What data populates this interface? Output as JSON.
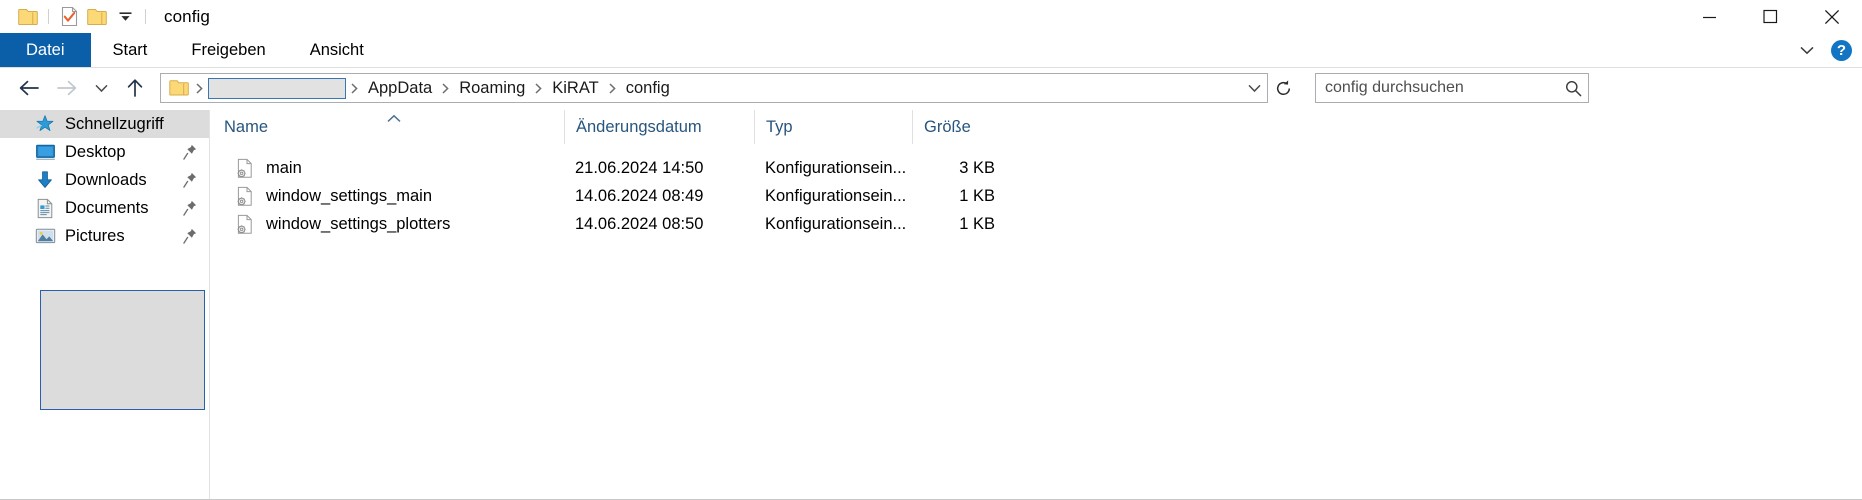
{
  "window": {
    "title": "config",
    "quick_access": [
      {
        "name": "folder-icon",
        "label": "Eigenschaften"
      },
      {
        "name": "properties-icon",
        "label": "Eigenschaften"
      },
      {
        "name": "new-folder-icon",
        "label": "Neuer Ordner"
      },
      {
        "name": "chevron-down-icon",
        "label": "Symbolleiste für den Schnellzugriff anpassen"
      }
    ],
    "caption": {
      "minimize": "Minimieren",
      "maximize": "Maximieren",
      "close": "Schließen"
    }
  },
  "ribbon": {
    "tabs": [
      {
        "label": "Datei",
        "active": true
      },
      {
        "label": "Start",
        "active": false
      },
      {
        "label": "Freigeben",
        "active": false
      },
      {
        "label": "Ansicht",
        "active": false
      }
    ],
    "collapse_label": "Menüband minimieren",
    "help_label": "?"
  },
  "address": {
    "back_label": "Zurück",
    "forward_label": "Vorwärts",
    "recent_label": "Zuletzt besuchte Orte",
    "up_label": "Eine Ebene nach oben",
    "crumbs": [
      {
        "label": "",
        "type": "redacted"
      },
      {
        "label": "AppData",
        "type": "text"
      },
      {
        "label": "Roaming",
        "type": "text"
      },
      {
        "label": "KiRAT",
        "type": "text"
      },
      {
        "label": "config",
        "type": "text"
      }
    ],
    "dropdown_label": "Vorherige Orte",
    "refresh_label": "Aktualisieren"
  },
  "search": {
    "placeholder": "config durchsuchen",
    "value": ""
  },
  "sidebar": {
    "items": [
      {
        "label": "Schnellzugriff",
        "icon": "star-icon",
        "selected": true,
        "pinned": false
      },
      {
        "label": "Desktop",
        "icon": "desktop-icon",
        "selected": false,
        "pinned": true
      },
      {
        "label": "Downloads",
        "icon": "download-icon",
        "selected": false,
        "pinned": true
      },
      {
        "label": "Documents",
        "icon": "documents-icon",
        "selected": false,
        "pinned": true
      },
      {
        "label": "Pictures",
        "icon": "pictures-icon",
        "selected": false,
        "pinned": true
      }
    ]
  },
  "filelist": {
    "columns": [
      {
        "label": "Name",
        "sorted": "asc"
      },
      {
        "label": "Änderungsdatum",
        "sorted": ""
      },
      {
        "label": "Typ",
        "sorted": ""
      },
      {
        "label": "Größe",
        "sorted": ""
      }
    ],
    "rows": [
      {
        "name": "main",
        "date": "21.06.2024 14:50",
        "type": "Konfigurationsein...",
        "size": "3 KB",
        "icon": "config-file-icon"
      },
      {
        "name": "window_settings_main",
        "date": "14.06.2024 08:49",
        "type": "Konfigurationsein...",
        "size": "1 KB",
        "icon": "config-file-icon"
      },
      {
        "name": "window_settings_plotters",
        "date": "14.06.2024 08:50",
        "type": "Konfigurationsein...",
        "size": "1 KB",
        "icon": "config-file-icon"
      }
    ]
  },
  "colors": {
    "accent": "#0b5ea8",
    "header_text": "#28557e",
    "selection": "#dcdcdc",
    "folder_yellow": "#fcd977",
    "help_blue": "#1275c4"
  }
}
